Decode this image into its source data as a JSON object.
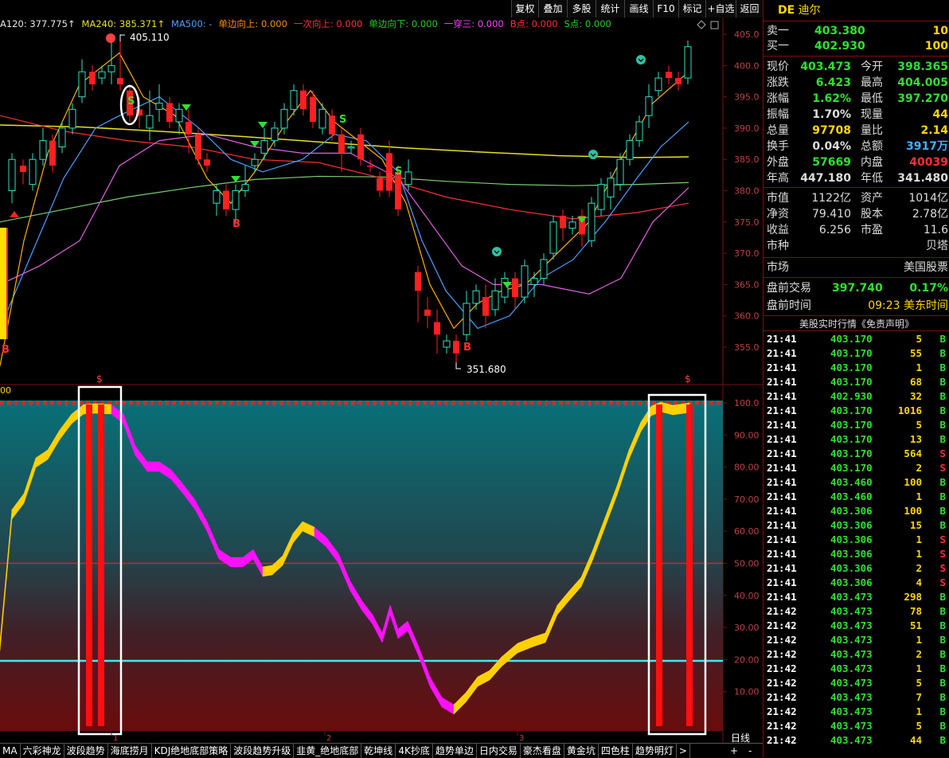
{
  "toolbar": {
    "buttons": [
      "复权",
      "叠加",
      "多股",
      "统计",
      "画线",
      "F10",
      "标记",
      "+自选",
      "返回"
    ]
  },
  "ma_legend": [
    {
      "text": "A120: 377.775↑",
      "color": "#e8e8e8"
    },
    {
      "text": "MA240: 385.371↑",
      "color": "#e8e020"
    },
    {
      "text": "MA500: -",
      "color": "#4aa0ff"
    },
    {
      "text": "单边向上: 0.000",
      "color": "#ff8c00"
    },
    {
      "text": "一次向上: 0.000",
      "color": "#ff3030"
    },
    {
      "text": "单边向下: 0.000",
      "color": "#20d020"
    },
    {
      "text": "一穿三: 0.000",
      "color": "#ff40ff"
    },
    {
      "text": "B点: 0.000",
      "color": "#ff3030"
    },
    {
      "text": "S点: 0.000",
      "color": "#20d020"
    }
  ],
  "price_axis": [
    "405.0",
    "400.0",
    "395.0",
    "390.0",
    "385.0",
    "380.0",
    "375.0",
    "370.0",
    "365.0",
    "360.0",
    "355.0"
  ],
  "osc_axis": [
    "100.0",
    "90.00",
    "80.00",
    "70.00",
    "60.00",
    "50.00",
    "40.00",
    "30.00",
    "20.00",
    "10.00"
  ],
  "osc_left_label": "00",
  "annotations": {
    "high": "405.110",
    "low": "351.680",
    "b_marks": [
      "B",
      "B",
      "B",
      "B"
    ],
    "s_marks": [
      "S",
      "S",
      "S"
    ],
    "dollar_marks": [
      "$",
      "$"
    ]
  },
  "time_axis": [
    "1",
    "2",
    "3"
  ],
  "bottom_tabs": [
    "MA",
    "六彩神龙",
    "波段趋势",
    "海底捞月",
    "KDJ绝地底部策略",
    "波段趋势升级",
    "韭黄_绝地底部",
    "乾坤线",
    "4K抄底",
    "趋势单边",
    "日内交易",
    "豪杰看盘",
    "黄金坑",
    "四色柱",
    "趋势明灯",
    ">"
  ],
  "period_label": "日线",
  "zoom_controls": [
    "+",
    "-"
  ],
  "quote": {
    "code": "DE",
    "name": "迪尔",
    "sell1_label": "卖一",
    "sell1_price": "403.380",
    "sell1_vol": "10",
    "buy1_label": "买一",
    "buy1_price": "402.930",
    "buy1_vol": "100",
    "fields": [
      [
        "现价",
        "403.473",
        "今开",
        "398.365"
      ],
      [
        "涨跌",
        "6.423",
        "最高",
        "404.005"
      ],
      [
        "涨幅",
        "1.62%",
        "最低",
        "397.270"
      ],
      [
        "振幅",
        "1.70%",
        "现量",
        "44"
      ],
      [
        "总量",
        "97708",
        "量比",
        "2.14"
      ],
      [
        "换手",
        "0.04%",
        "总额",
        "3917万"
      ],
      [
        "外盘",
        "57669",
        "内盘",
        "40039"
      ],
      [
        "年高",
        "447.180",
        "年低",
        "341.480"
      ]
    ],
    "fields2": [
      [
        "市值",
        "1122亿",
        "资产",
        "1014亿"
      ],
      [
        "净资",
        "79.410",
        "股本",
        "2.78亿"
      ],
      [
        "收益",
        "6.256",
        "市盈",
        "11.6"
      ],
      [
        "市种",
        "",
        "",
        "贝塔"
      ]
    ],
    "market_label": "市场",
    "market_value": "美国股票",
    "premarket_label": "盘前交易",
    "premarket_price": "397.740",
    "premarket_pct": "0.17%",
    "pretime_label": "盘前时间",
    "pretime_value": "09:23 美东时间",
    "ticks_title": "美股实时行情《免责声明》"
  },
  "ticks": [
    [
      "21:41",
      "403.170",
      "5",
      "B"
    ],
    [
      "21:41",
      "403.170",
      "55",
      "B"
    ],
    [
      "21:41",
      "403.170",
      "1",
      "B"
    ],
    [
      "21:41",
      "403.170",
      "68",
      "B"
    ],
    [
      "21:41",
      "402.930",
      "32",
      "B"
    ],
    [
      "21:41",
      "403.170",
      "1016",
      "B"
    ],
    [
      "21:41",
      "403.170",
      "5",
      "B"
    ],
    [
      "21:41",
      "403.170",
      "13",
      "B"
    ],
    [
      "21:41",
      "403.170",
      "564",
      "S"
    ],
    [
      "21:41",
      "403.170",
      "2",
      "S"
    ],
    [
      "21:41",
      "403.460",
      "100",
      "B"
    ],
    [
      "21:41",
      "403.460",
      "1",
      "B"
    ],
    [
      "21:41",
      "403.306",
      "100",
      "B"
    ],
    [
      "21:41",
      "403.306",
      "15",
      "B"
    ],
    [
      "21:41",
      "403.306",
      "1",
      "S"
    ],
    [
      "21:41",
      "403.306",
      "1",
      "S"
    ],
    [
      "21:41",
      "403.306",
      "2",
      "S"
    ],
    [
      "21:41",
      "403.306",
      "4",
      "S"
    ],
    [
      "21:41",
      "403.473",
      "298",
      "B"
    ],
    [
      "21:42",
      "403.473",
      "78",
      "B"
    ],
    [
      "21:42",
      "403.473",
      "51",
      "B"
    ],
    [
      "21:42",
      "403.473",
      "1",
      "B"
    ],
    [
      "21:42",
      "403.473",
      "2",
      "B"
    ],
    [
      "21:42",
      "403.473",
      "1",
      "B"
    ],
    [
      "21:42",
      "403.473",
      "5",
      "B"
    ],
    [
      "21:42",
      "403.473",
      "7",
      "B"
    ],
    [
      "21:42",
      "403.473",
      "1",
      "B"
    ],
    [
      "21:42",
      "403.473",
      "5",
      "B"
    ],
    [
      "21:42",
      "403.473",
      "44",
      "B"
    ]
  ],
  "colors": {
    "up": "#ff2020",
    "down": "#20d0d0",
    "green": "#30e030",
    "yellow": "#ffd700",
    "magenta": "#ff00ff",
    "panel_border": "#7a1010"
  }
}
